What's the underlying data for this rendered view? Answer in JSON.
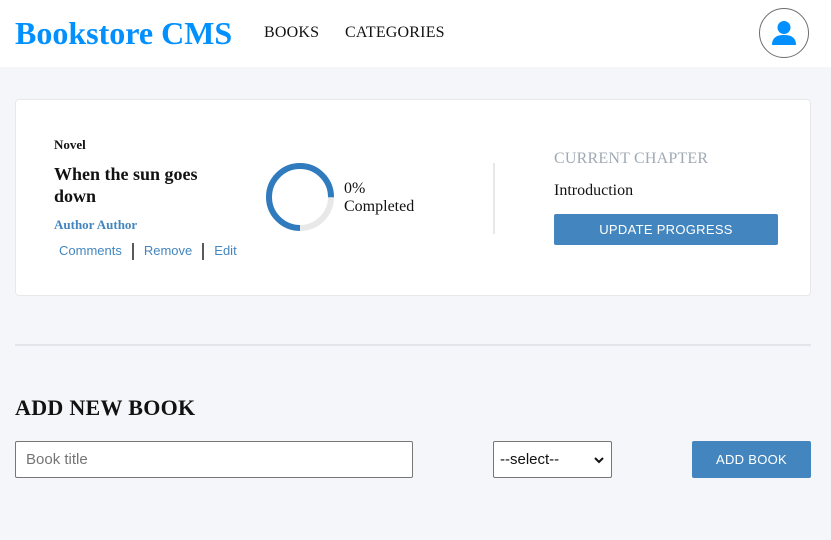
{
  "header": {
    "brand": "Bookstore CMS",
    "nav": [
      {
        "label": "BOOKS"
      },
      {
        "label": "CATEGORIES"
      }
    ],
    "user_icon": "user-icon"
  },
  "book": {
    "genre": "Novel",
    "title": "When the sun goes down",
    "author": "Author Author",
    "actions": {
      "comments": "Comments",
      "remove": "Remove",
      "edit": "Edit"
    },
    "progress": {
      "percent_text": "0%",
      "label": "Completed",
      "ring_fill_fraction": 0.75
    },
    "chapter": {
      "heading": "CURRENT CHAPTER",
      "name": "Introduction",
      "button": "UPDATE PROGRESS"
    }
  },
  "form": {
    "heading": "ADD NEW BOOK",
    "title_placeholder": "Book title",
    "title_value": "",
    "category_selected": "--select--",
    "submit": "ADD BOOK"
  },
  "colors": {
    "brand": "#0290ff",
    "accent": "#4386bf",
    "background": "#f5f6fa",
    "muted": "#a0aab5"
  }
}
